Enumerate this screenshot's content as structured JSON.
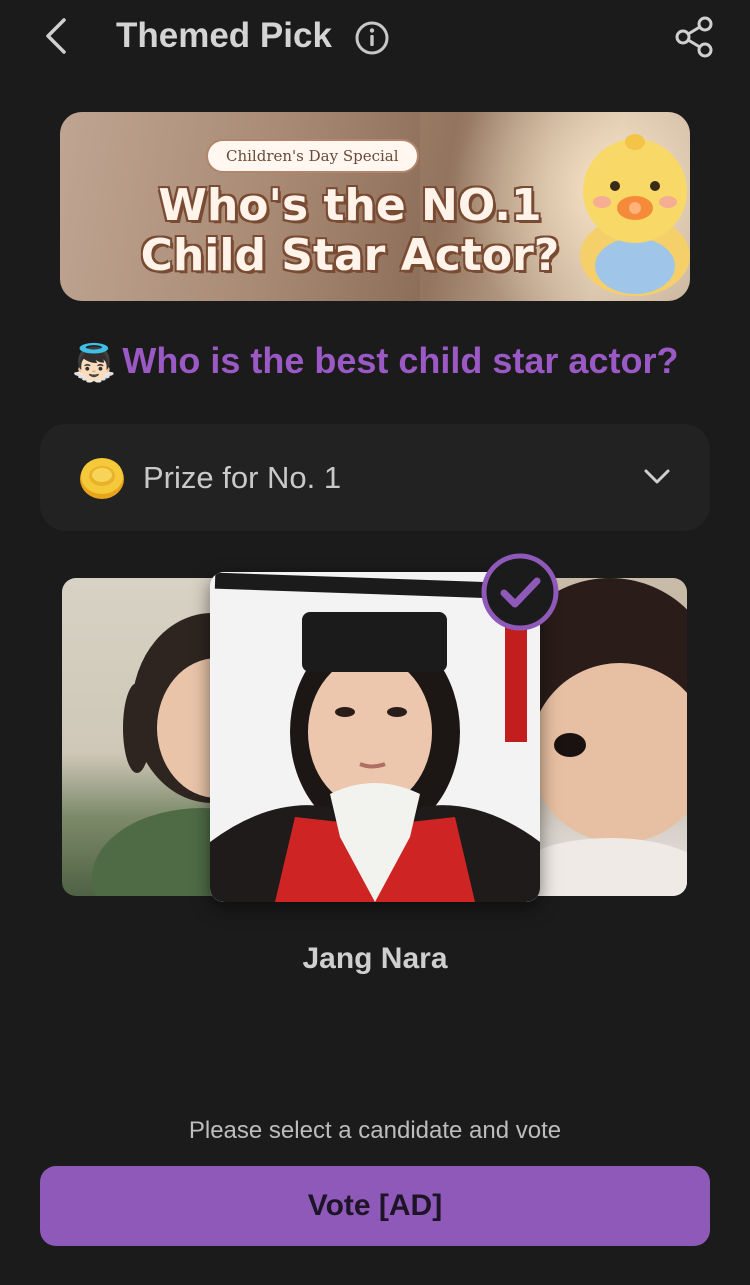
{
  "header": {
    "title": "Themed Pick",
    "icons": [
      "back-arrow-icon",
      "info-icon",
      "share-icon"
    ]
  },
  "banner": {
    "tag": "Children's Day Special",
    "line1": "Who's the NO.1",
    "line2": "Child Star Actor?"
  },
  "question": {
    "emoji": "👼🏻",
    "text": "Who is the best child star actor?"
  },
  "prize": {
    "label": "Prize for No. 1",
    "icon": "coin-icon"
  },
  "candidates": {
    "selected_name": "Jang Nara"
  },
  "footer": {
    "hint": "Please select a candidate and vote",
    "vote_label": "Vote [AD]"
  },
  "colors": {
    "background": "#1b1b1b",
    "accent": "#8e59b8",
    "question": "#9b59c5"
  }
}
